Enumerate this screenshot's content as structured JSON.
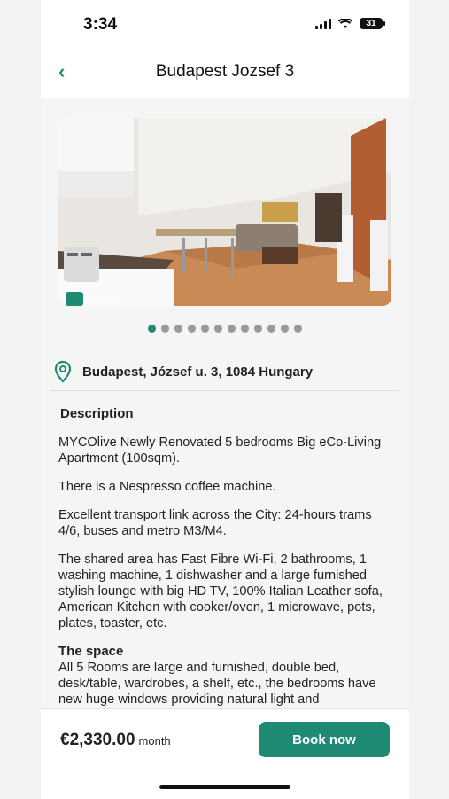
{
  "status": {
    "time": "3:34",
    "battery": "31"
  },
  "header": {
    "title": "Budapest Jozsef 3"
  },
  "gallery": {
    "photo_label": "MYCOLIVE",
    "total": 12,
    "active_index": 0
  },
  "address": "Budapest, József u. 3, 1084 Hungary",
  "description": {
    "title": "Description",
    "paragraphs": [
      "MYCOlive Newly Renovated 5 bedrooms Big eCo-Living Apartment (100sqm).",
      "There is a Nespresso coffee machine.",
      "Excellent transport link across the City: 24-hours trams 4/6, buses and metro M3/M4.",
      "The shared area has Fast Fibre Wi-Fi, 2 bathrooms, 1 washing machine, 1 dishwasher and a large furnished stylish lounge with big HD TV, 100% Italian Leather sofa, American Kitchen with cooker/oven, 1 microwave, pots, plates, toaster, etc."
    ],
    "space_title": "The space",
    "space_text": "All 5 Rooms are large and furnished, double bed, desk/table, wardrobes, a shelf, etc., the bedrooms have new huge windows providing natural light and"
  },
  "footer": {
    "price": "€2,330.00",
    "unit": "month",
    "book_label": "Book now"
  },
  "colors": {
    "accent": "#1f8a73"
  }
}
